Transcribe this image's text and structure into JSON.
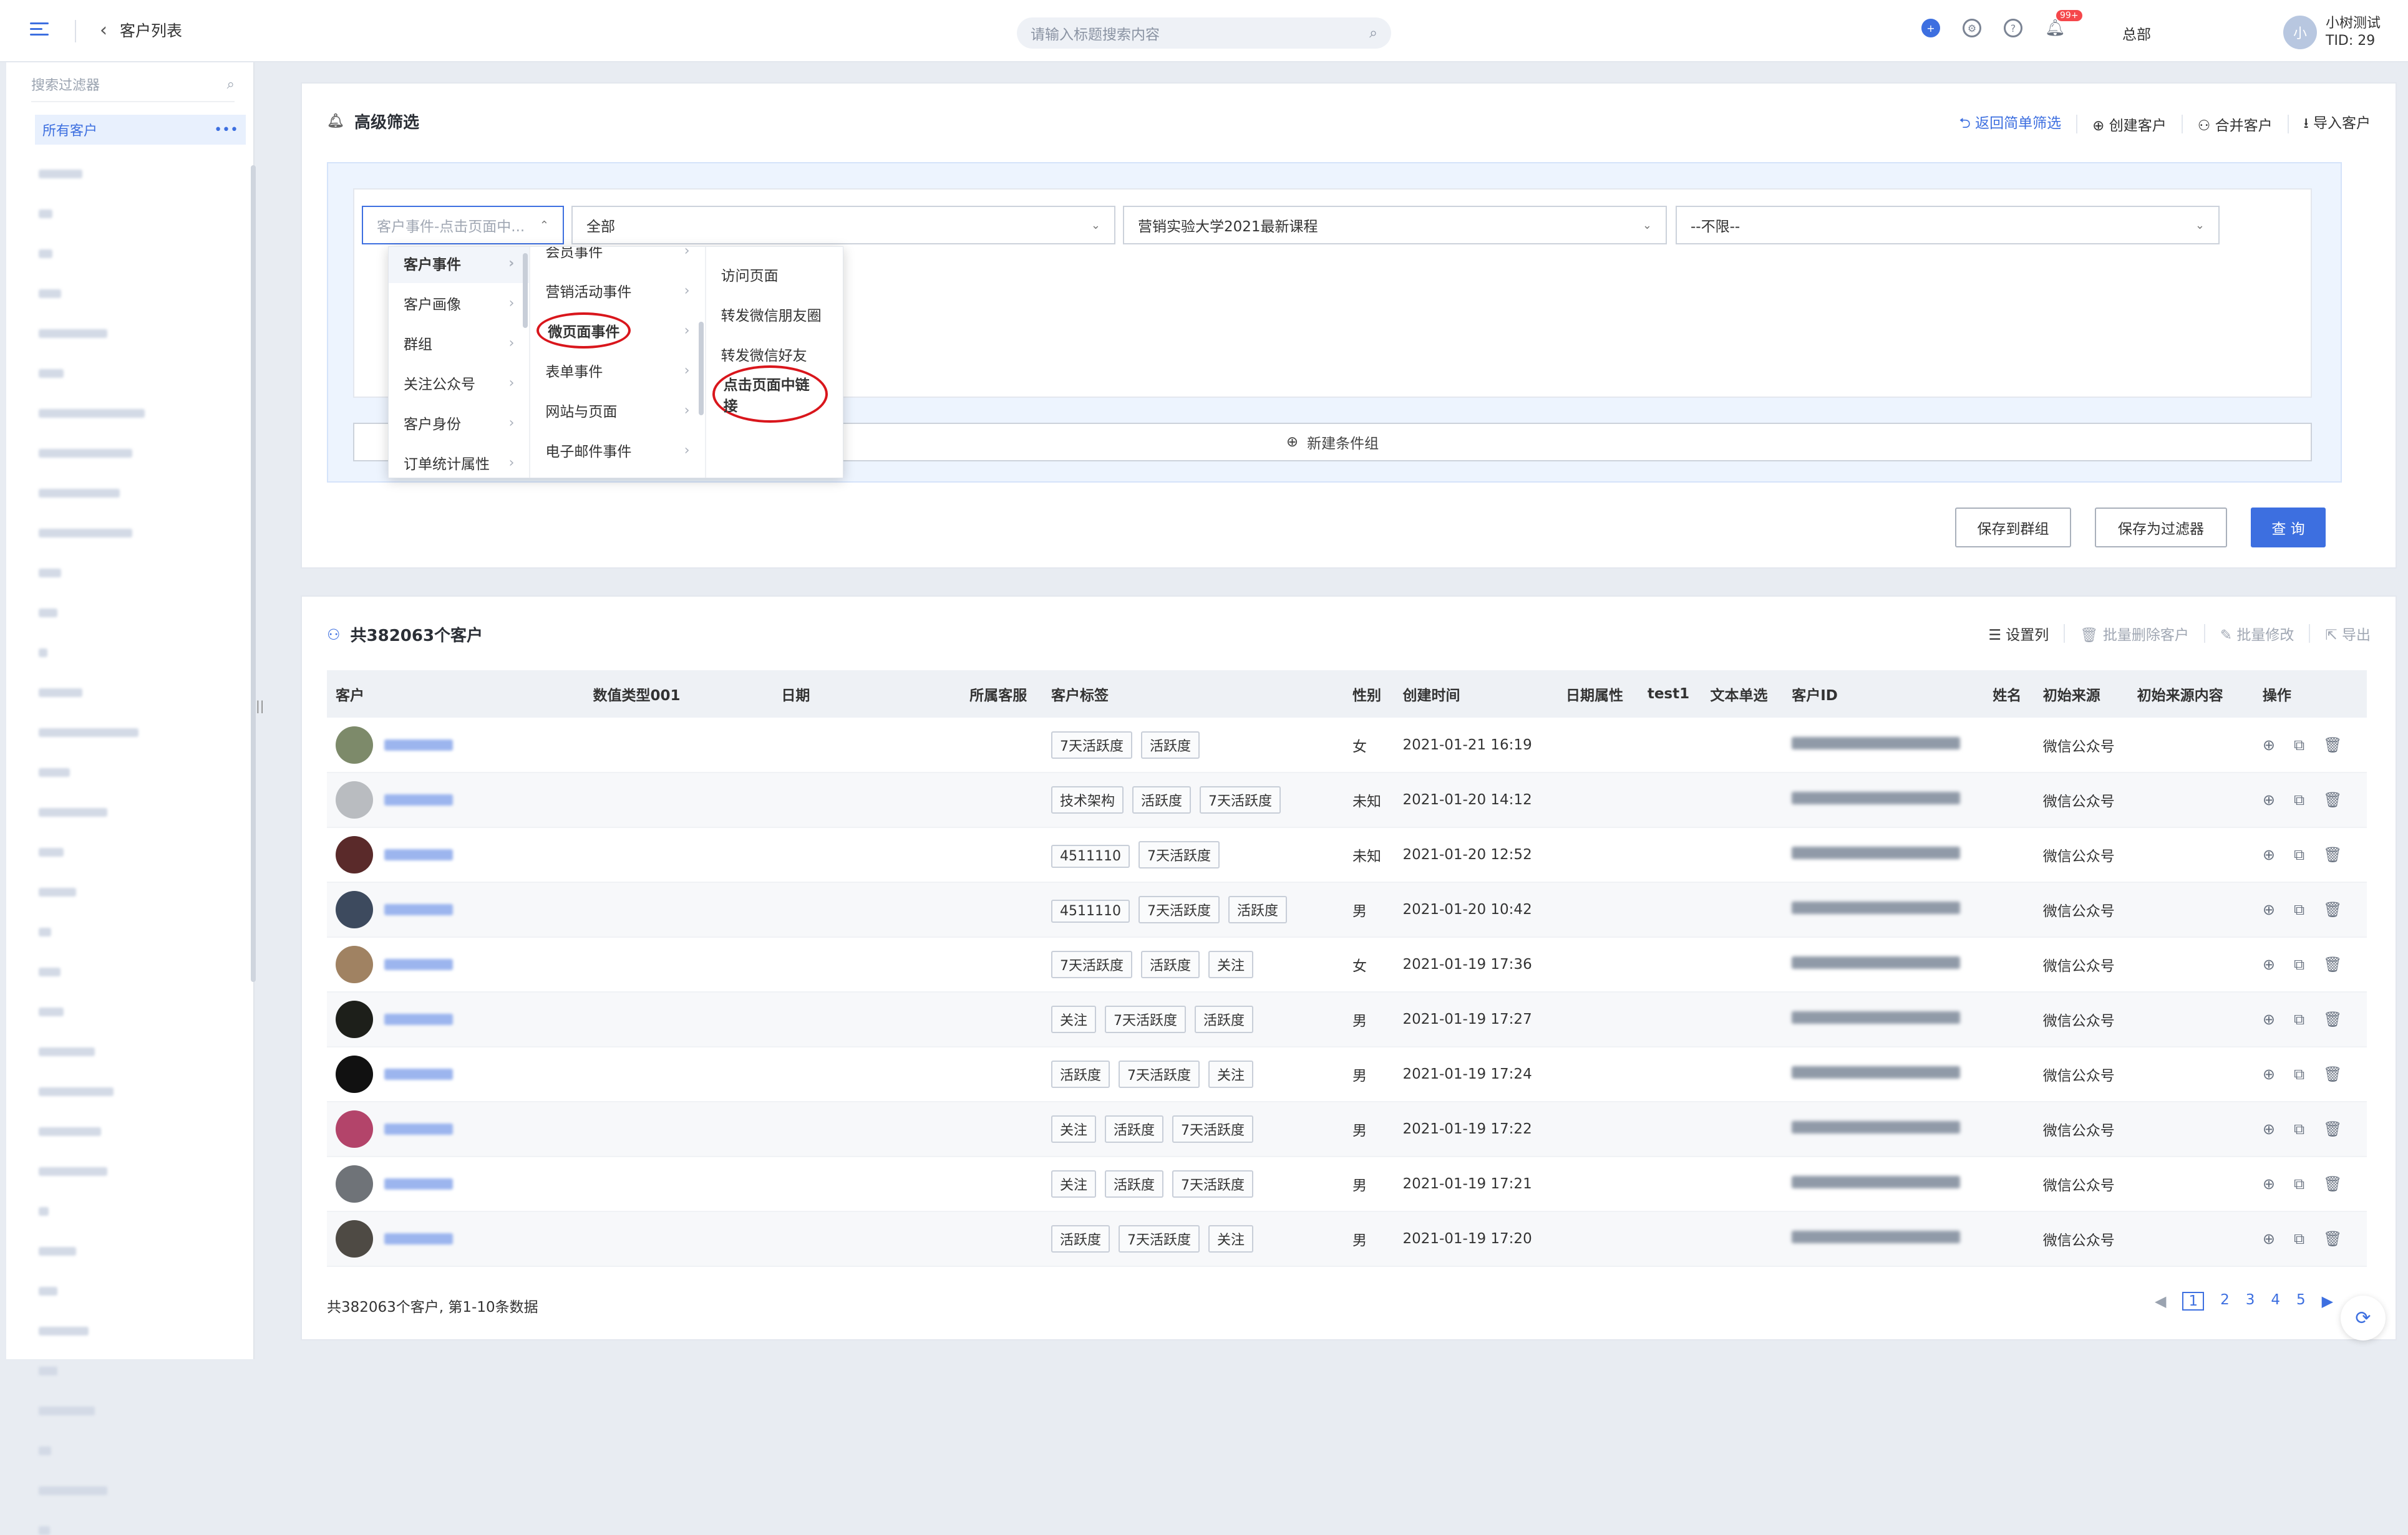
{
  "header": {
    "back_label": "客户列表",
    "search_placeholder": "请输入标题搜索内容",
    "notif_badge": "99+",
    "org": "总部",
    "user_name": "小树测试",
    "user_tid": "TID: 29",
    "avatar_text": "小"
  },
  "sidebar": {
    "filter_placeholder": "搜索过滤器",
    "all_customers": "所有客户"
  },
  "filter_panel": {
    "title": "高级筛选",
    "back_simple": "返回简单筛选",
    "create_customer": "创建客户",
    "merge_customer": "合并客户",
    "import_customer": "导入客户",
    "select1": "客户事件-点击页面中...",
    "select2": "全部",
    "select3": "营销实验大学2021最新课程",
    "select4": "--不限--",
    "new_group": "新建条件组",
    "save_group": "保存到群组",
    "save_filter": "保存为过滤器",
    "query": "查 询"
  },
  "dropdown": {
    "col1": [
      "客户事件",
      "客户画像",
      "群组",
      "关注公众号",
      "客户身份",
      "订单统计属性"
    ],
    "col2": [
      "会员事件",
      "营销活动事件",
      "微页面事件",
      "表单事件",
      "网站与页面",
      "电子邮件事件"
    ],
    "col3": [
      "访问页面",
      "转发微信朋友圈",
      "转发微信好友",
      "点击页面中链接"
    ]
  },
  "list_panel": {
    "title": "共382063个客户",
    "set_columns": "设置列",
    "batch_delete": "批量删除客户",
    "batch_edit": "批量修改",
    "export": "导出",
    "columns": [
      "客户",
      "数值类型001",
      "日期",
      "所属客服",
      "客户标签",
      "性别",
      "创建时间",
      "日期属性",
      "test1",
      "文本单选",
      "客户ID",
      "姓名",
      "初始来源",
      "初始来源内容",
      "操作"
    ],
    "rows": [
      {
        "tags": [
          "7天活跃度",
          "活跃度"
        ],
        "gender": "女",
        "created": "2021-01-21 16:19",
        "source": "微信公众号",
        "avatar": "#7d8a6a"
      },
      {
        "tags": [
          "技术架构",
          "活跃度",
          "7天活跃度"
        ],
        "gender": "未知",
        "created": "2021-01-20 14:12",
        "source": "微信公众号",
        "avatar": "#b9bcc0"
      },
      {
        "tags": [
          "4511110",
          "7天活跃度"
        ],
        "gender": "未知",
        "created": "2021-01-20 12:52",
        "source": "微信公众号",
        "avatar": "#5a2a2a"
      },
      {
        "tags": [
          "4511110",
          "7天活跃度",
          "活跃度"
        ],
        "gender": "男",
        "created": "2021-01-20 10:42",
        "source": "微信公众号",
        "avatar": "#3d4a5e"
      },
      {
        "tags": [
          "7天活跃度",
          "活跃度",
          "关注"
        ],
        "gender": "女",
        "created": "2021-01-19 17:36",
        "source": "微信公众号",
        "avatar": "#a08262"
      },
      {
        "tags": [
          "关注",
          "7天活跃度",
          "活跃度"
        ],
        "gender": "男",
        "created": "2021-01-19 17:27",
        "source": "微信公众号",
        "avatar": "#1d1f1a"
      },
      {
        "tags": [
          "活跃度",
          "7天活跃度",
          "关注"
        ],
        "gender": "男",
        "created": "2021-01-19 17:24",
        "source": "微信公众号",
        "avatar": "#111111"
      },
      {
        "tags": [
          "关注",
          "活跃度",
          "7天活跃度"
        ],
        "gender": "男",
        "created": "2021-01-19 17:22",
        "source": "微信公众号",
        "avatar": "#b3446a"
      },
      {
        "tags": [
          "关注",
          "活跃度",
          "7天活跃度"
        ],
        "gender": "男",
        "created": "2021-01-19 17:21",
        "source": "微信公众号",
        "avatar": "#6f7378"
      },
      {
        "tags": [
          "活跃度",
          "7天活跃度",
          "关注"
        ],
        "gender": "男",
        "created": "2021-01-19 17:20",
        "source": "微信公众号",
        "avatar": "#4e4a44"
      }
    ],
    "footer": "共382063个客户, 第1-10条数据",
    "pages": [
      "1",
      "2",
      "3",
      "4",
      "5"
    ]
  },
  "colors": {
    "accent": "#3d6fe0",
    "highlight": "#d9161c"
  }
}
